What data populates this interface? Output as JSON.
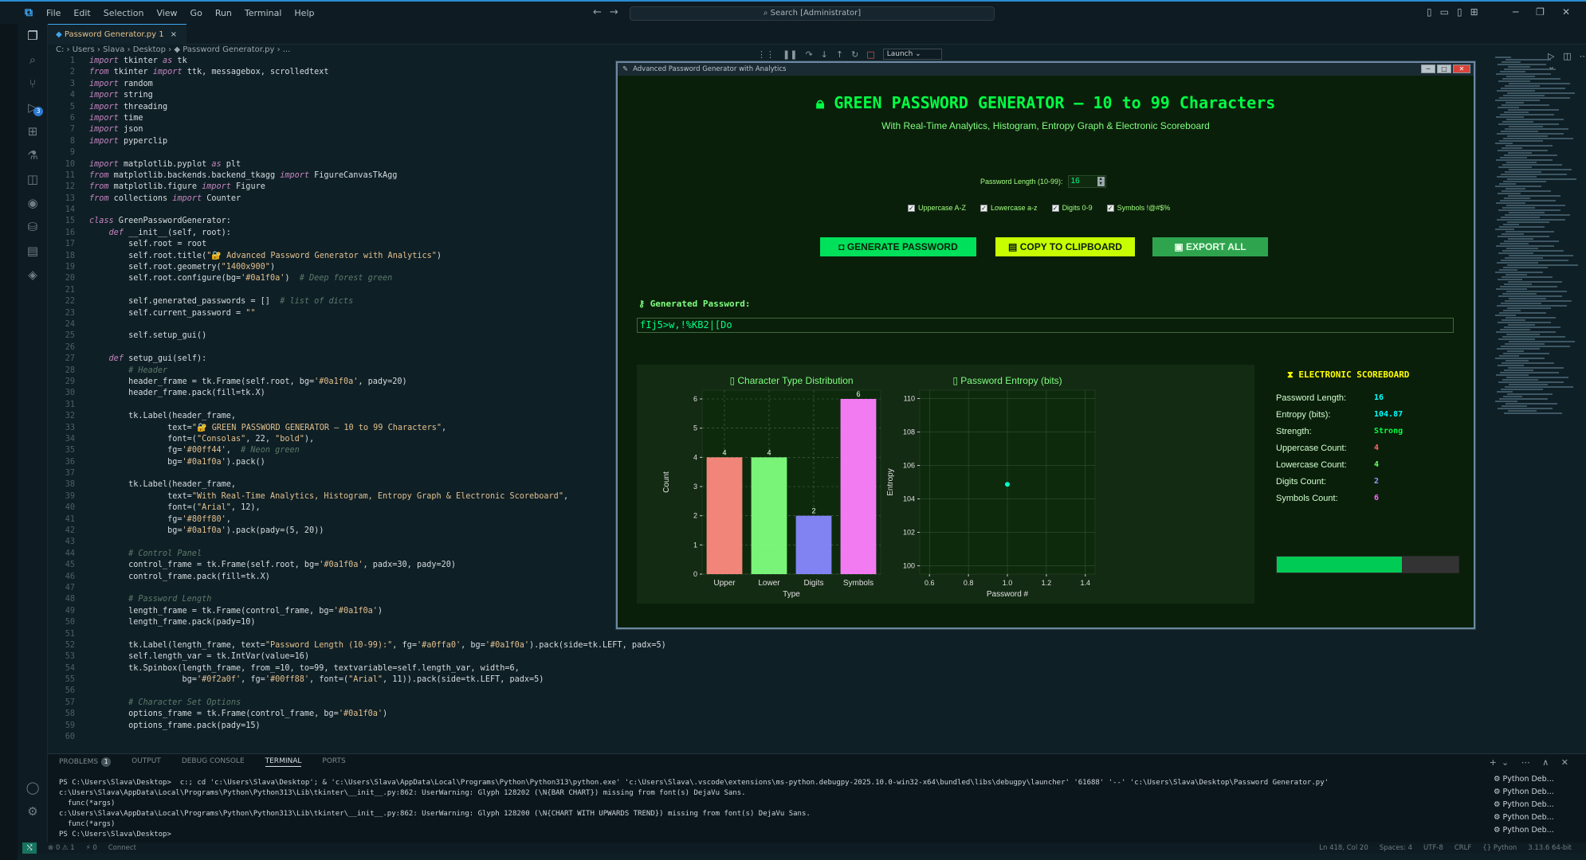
{
  "menu": [
    "File",
    "Edit",
    "Selection",
    "View",
    "Go",
    "Run",
    "Terminal",
    "Help"
  ],
  "search": "Search [Administrator]",
  "tab": {
    "label": "Password Generator.py 1",
    "close": "×"
  },
  "debug": {
    "config": "Launch"
  },
  "breadcrumb": "C: › Users › Slava › Desktop › ◆ Password Generator.py › ...",
  "code_lines": [
    "import tkinter as tk",
    "from tkinter import ttk, messagebox, scrolledtext",
    "import random",
    "import string",
    "import threading",
    "import time",
    "import json",
    "import pyperclip",
    "",
    "import matplotlib.pyplot as plt",
    "from matplotlib.backends.backend_tkagg import FigureCanvasTkAgg",
    "from matplotlib.figure import Figure",
    "from collections import Counter",
    "",
    "class GreenPasswordGenerator:",
    "    def __init__(self, root):",
    "        self.root = root",
    "        self.root.title(\"🔐 Advanced Password Generator with Analytics\")",
    "        self.root.geometry(\"1400x900\")",
    "        self.root.configure(bg='#0a1f0a')  # Deep forest green",
    "",
    "        self.generated_passwords = []  # list of dicts",
    "        self.current_password = \"\"",
    "",
    "        self.setup_gui()",
    "",
    "    def setup_gui(self):",
    "        # Header",
    "        header_frame = tk.Frame(self.root, bg='#0a1f0a', pady=20)",
    "        header_frame.pack(fill=tk.X)",
    "",
    "        tk.Label(header_frame,",
    "                text=\"🔐 GREEN PASSWORD GENERATOR — 10 to 99 Characters\",",
    "                font=(\"Consolas\", 22, \"bold\"),",
    "                fg='#00ff44',  # Neon green",
    "                bg='#0a1f0a').pack()",
    "",
    "        tk.Label(header_frame,",
    "                text=\"With Real-Time Analytics, Histogram, Entropy Graph & Electronic Scoreboard\",",
    "                font=(\"Arial\", 12),",
    "                fg='#80ff80',",
    "                bg='#0a1f0a').pack(pady=(5, 20))",
    "",
    "        # Control Panel",
    "        control_frame = tk.Frame(self.root, bg='#0a1f0a', padx=30, pady=20)",
    "        control_frame.pack(fill=tk.X)",
    "",
    "        # Password Length",
    "        length_frame = tk.Frame(control_frame, bg='#0a1f0a')",
    "        length_frame.pack(pady=10)",
    "",
    "        tk.Label(length_frame, text=\"Password Length (10-99):\", fg='#a0ffa0', bg='#0a1f0a').pack(side=tk.LEFT, padx=5)",
    "        self.length_var = tk.IntVar(value=16)",
    "        tk.Spinbox(length_frame, from_=10, to=99, textvariable=self.length_var, width=6,",
    "                   bg='#0f2a0f', fg='#00ff88', font=(\"Arial\", 11)).pack(side=tk.LEFT, padx=5)",
    "",
    "        # Character Set Options",
    "        options_frame = tk.Frame(control_frame, bg='#0a1f0a')",
    "        options_frame.pack(pady=15)",
    ""
  ],
  "panel": {
    "tabs": [
      "PROBLEMS",
      "OUTPUT",
      "DEBUG CONSOLE",
      "TERMINAL",
      "PORTS"
    ],
    "problems_count": "1",
    "terminal": [
      "PS C:\\Users\\Slava\\Desktop>  c:; cd 'c:\\Users\\Slava\\Desktop'; & 'c:\\Users\\Slava\\AppData\\Local\\Programs\\Python\\Python313\\python.exe' 'c:\\Users\\Slava\\.vscode\\extensions\\ms-python.debugpy-2025.10.0-win32-x64\\bundled\\libs\\debugpy\\launcher' '61688' '--' 'c:\\Users\\Slava\\Desktop\\Password Generator.py'",
      "c:\\Users\\Slava\\AppData\\Local\\Programs\\Python\\Python313\\Lib\\tkinter\\__init__.py:862: UserWarning: Glyph 128202 (\\N{BAR CHART}) missing from font(s) DejaVu Sans.",
      "  func(*args)",
      "c:\\Users\\Slava\\AppData\\Local\\Programs\\Python\\Python313\\Lib\\tkinter\\__init__.py:862: UserWarning: Glyph 128200 (\\N{CHART WITH UPWARDS TREND}) missing from font(s) DejaVu Sans.",
      "  func(*args)",
      "PS C:\\Users\\Slava\\Desktop> "
    ],
    "sessions": [
      "Python Deb...",
      "Python Deb...",
      "Python Deb...",
      "Python Deb...",
      "Python Deb..."
    ]
  },
  "status": {
    "left": [
      "⊗ 0 ⚠ 1",
      "⚡ 0",
      "Connect"
    ],
    "right": [
      "Ln 418, Col 20",
      "Spaces: 4",
      "UTF-8",
      "CRLF",
      "{} Python",
      "3.13.6 64-bit"
    ]
  },
  "app": {
    "window_title": "Advanced Password Generator with Analytics",
    "header": "GREEN PASSWORD GENERATOR — 10 to 99 Characters",
    "subtitle": "With Real-Time Analytics, Histogram, Entropy Graph & Electronic Scoreboard",
    "length_label": "Password Length (10-99):",
    "length_value": "16",
    "options": [
      "Uppercase A-Z",
      "Lowercase a-z",
      "Digits 0-9",
      "Symbols !@#$%"
    ],
    "buttons": {
      "generate": "GENERATE PASSWORD",
      "copy": "COPY TO CLIPBOARD",
      "export": "EXPORT ALL"
    },
    "generated_label": "Generated Password:",
    "password": "fIj5>w,!%KB2|[Do",
    "scoreboard": {
      "title": "ELECTRONIC SCOREBOARD",
      "rows": [
        {
          "k": "Password Length:",
          "v": "16",
          "c": "#00ffff"
        },
        {
          "k": "Entropy (bits):",
          "v": "104.87",
          "c": "#00ffff"
        },
        {
          "k": "Strength:",
          "v": "Strong",
          "c": "#00ff44"
        },
        {
          "k": "Uppercase Count:",
          "v": "4",
          "c": "#ff6666"
        },
        {
          "k": "Lowercase Count:",
          "v": "4",
          "c": "#66ff66"
        },
        {
          "k": "Digits Count:",
          "v": "2",
          "c": "#9999ff"
        },
        {
          "k": "Symbols Count:",
          "v": "6",
          "c": "#ff66ff"
        }
      ],
      "strength_fraction": 0.69
    }
  },
  "chart_data": [
    {
      "type": "bar",
      "title": "▯ Character Type Distribution",
      "xlabel": "Type",
      "ylabel": "Count",
      "categories": [
        "Upper",
        "Lower",
        "Digits",
        "Symbols"
      ],
      "values": [
        4,
        4,
        2,
        6
      ],
      "colors": [
        "#ff8a80",
        "#80ff80",
        "#8888ff",
        "#ff80ff"
      ],
      "ylim": [
        0,
        6.3
      ],
      "yticks": [
        0,
        1,
        2,
        3,
        4,
        5,
        6
      ],
      "grid": true
    },
    {
      "type": "scatter",
      "title": "▯ Password Entropy (bits)",
      "xlabel": "Password #",
      "ylabel": "Entropy",
      "x": [
        1.0
      ],
      "y": [
        104.87
      ],
      "xlim": [
        0.55,
        1.45
      ],
      "ylim": [
        99.5,
        110.5
      ],
      "xticks": [
        0.6,
        0.8,
        1.0,
        1.2,
        1.4
      ],
      "yticks": [
        100,
        102,
        104,
        106,
        108,
        110
      ],
      "point_color": "#00ffcc",
      "grid": true
    }
  ]
}
